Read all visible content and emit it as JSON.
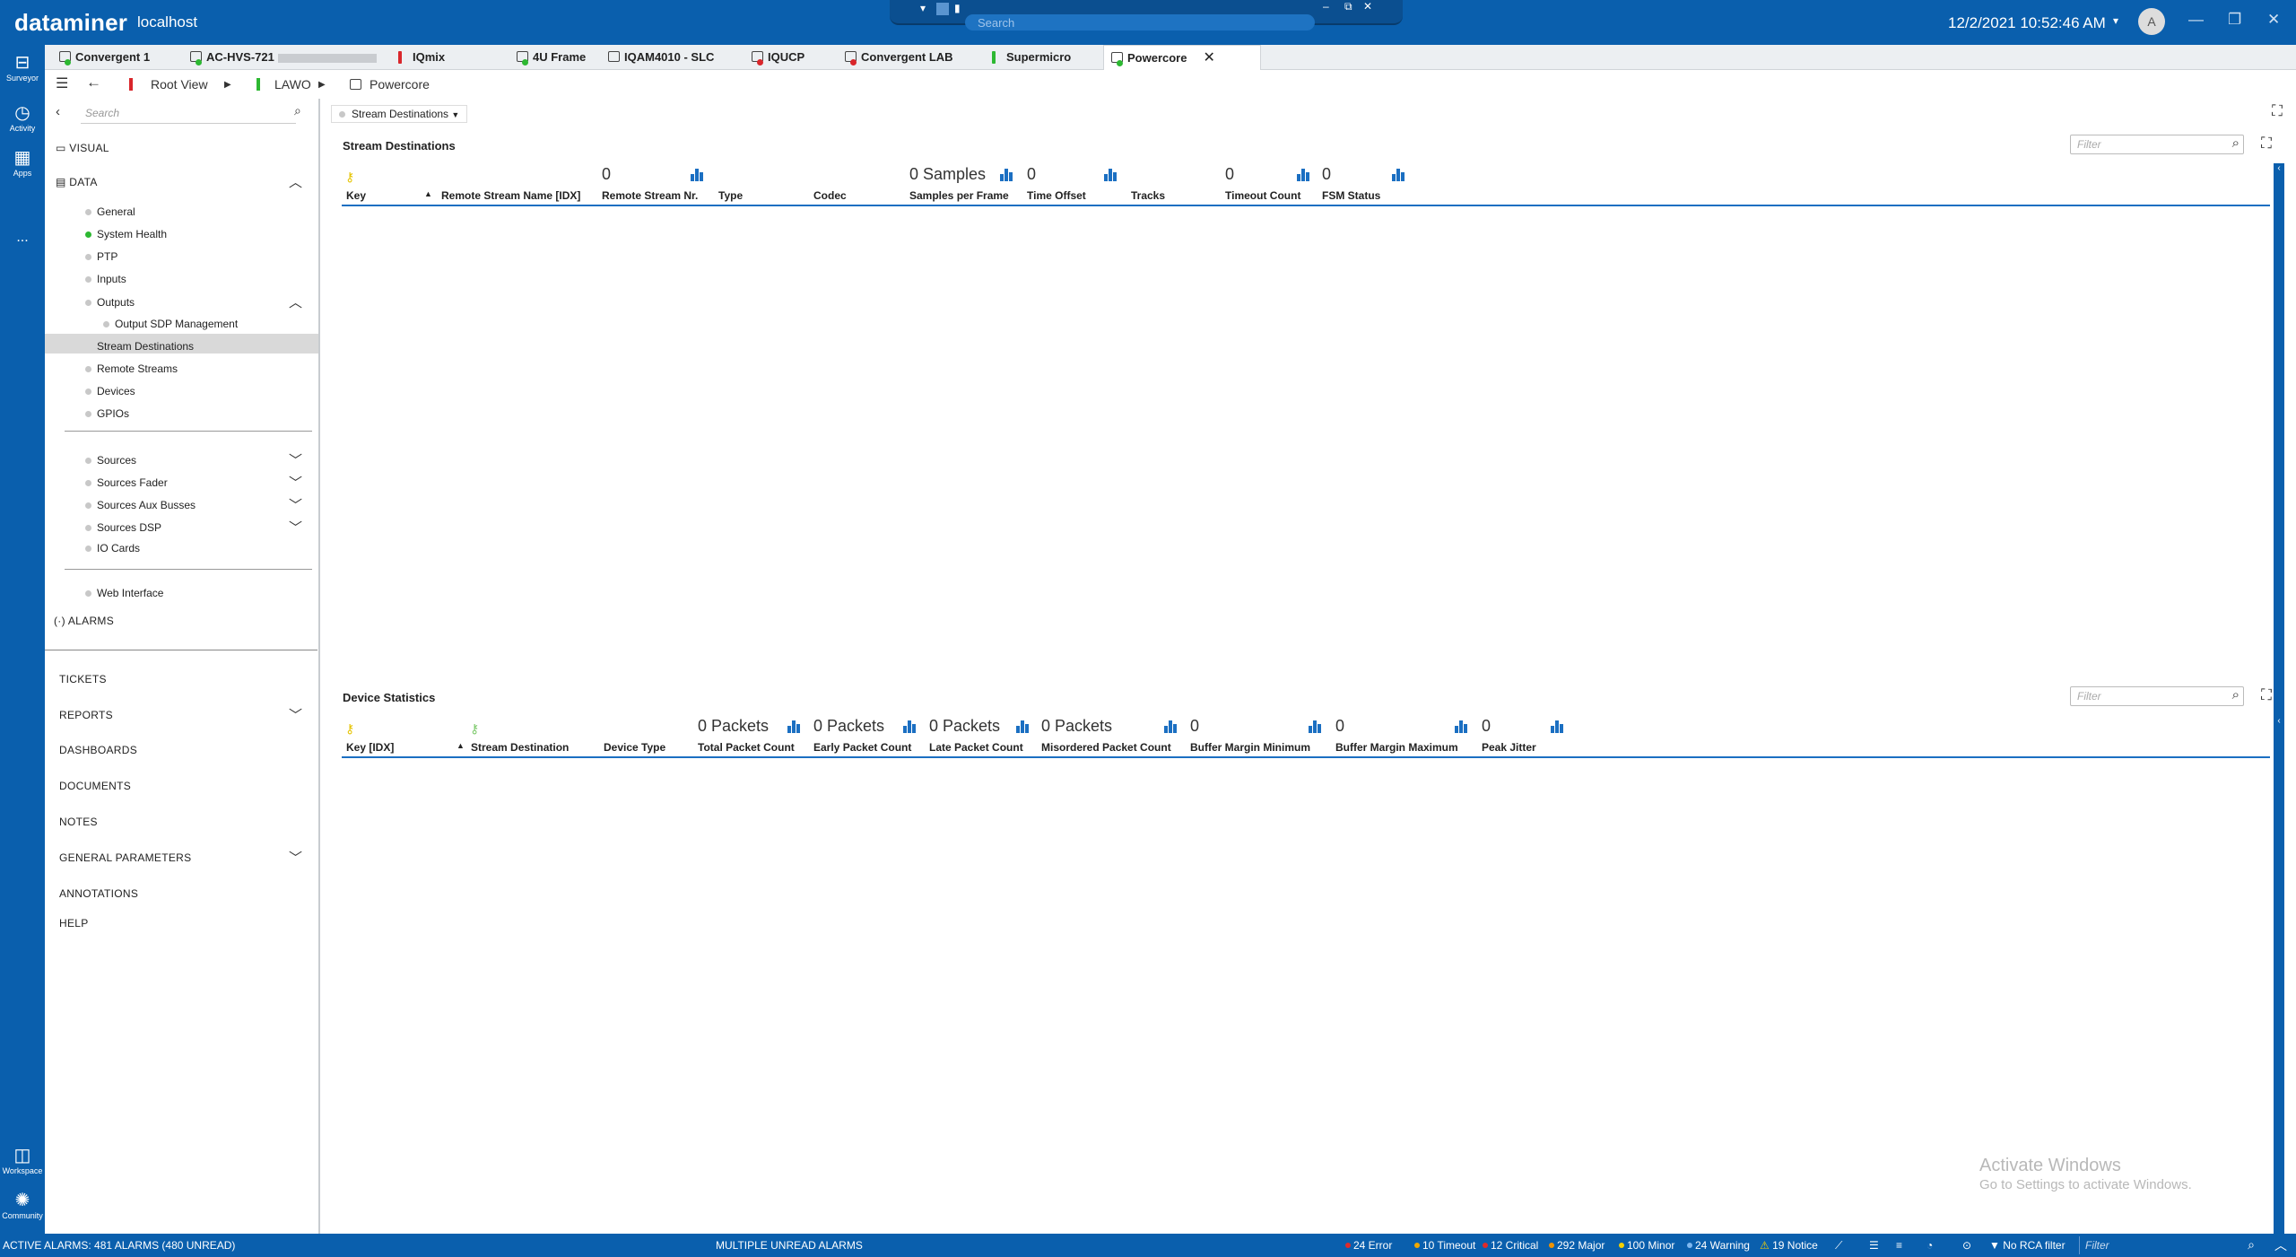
{
  "app": {
    "brand": "dataminer",
    "host": "localhost",
    "datetime": "12/2/2021 10:52:46 AM",
    "user_initial": "A",
    "search_placeholder": "Search",
    "window_search_icons": [
      "chevron-down-icon",
      "apps-icon",
      "signal-icon"
    ]
  },
  "rail": {
    "surveyor": "Surveyor",
    "activity": "Activity",
    "apps": "Apps",
    "more": "...",
    "workspace": "Workspace",
    "community": "Community"
  },
  "tabs": [
    {
      "label": "Convergent 1",
      "status": "#2db832"
    },
    {
      "label": "AC-HVS-721",
      "status": "#2db832"
    },
    {
      "label": "IQmix",
      "status": "#d9262b"
    },
    {
      "label": "4U Frame",
      "status": "#2db832"
    },
    {
      "label": "IQAM4010 - SLC",
      "status": "#c8c8c8"
    },
    {
      "label": "IQUCP",
      "status": "#d9262b"
    },
    {
      "label": "Convergent LAB",
      "status": "#d9262b"
    },
    {
      "label": "Supermicro",
      "status": "#2db832"
    },
    {
      "label": "Powercore",
      "status": "#2db832"
    }
  ],
  "breadcrumb": {
    "root": "Root View",
    "lawo": "LAWO",
    "powercore": "Powercore"
  },
  "sidebar": {
    "search_placeholder": "Search",
    "visual": "VISUAL",
    "data": "DATA",
    "items": {
      "general": "General",
      "system_health": "System Health",
      "ptp": "PTP",
      "inputs": "Inputs",
      "outputs": "Outputs",
      "output_sdp": "Output SDP Management",
      "stream_destinations": "Stream Destinations",
      "remote_streams": "Remote Streams",
      "devices": "Devices",
      "gpios": "GPIOs",
      "sources": "Sources",
      "sources_fader": "Sources Fader",
      "sources_aux": "Sources Aux Busses",
      "sources_dsp": "Sources DSP",
      "io_cards": "IO Cards",
      "web_interface": "Web Interface"
    },
    "alarms": "ALARMS",
    "sections": {
      "tickets": "TICKETS",
      "reports": "REPORTS",
      "dashboards": "DASHBOARDS",
      "documents": "DOCUMENTS",
      "notes": "NOTES",
      "general_parameters": "GENERAL PARAMETERS",
      "annotations": "ANNOTATIONS",
      "help": "HELP"
    }
  },
  "page_select": "Stream Destinations",
  "panel1": {
    "title": "Stream Destinations",
    "filter_placeholder": "Filter",
    "columns": [
      "Key",
      "Remote Stream Name [IDX]",
      "Remote Stream Nr.",
      "Type",
      "Codec",
      "Samples per Frame",
      "Time Offset",
      "Tracks",
      "Timeout Count",
      "FSM Status"
    ],
    "aggregates": {
      "remote_stream_nr": "0",
      "samples_per_frame": "0 Samples",
      "time_offset": "0",
      "timeout_count": "0",
      "fsm_status": "0"
    }
  },
  "panel2": {
    "title": "Device Statistics",
    "filter_placeholder": "Filter",
    "columns": [
      "Key [IDX]",
      "Stream Destination",
      "Device Type",
      "Total Packet Count",
      "Early Packet Count",
      "Late Packet Count",
      "Misordered Packet Count",
      "Buffer Margin Minimum",
      "Buffer Margin Maximum",
      "Peak Jitter"
    ],
    "aggregates": {
      "total_packet_count": "0 Packets",
      "early_packet_count": "0 Packets",
      "late_packet_count": "0 Packets",
      "misordered_packet_count": "0 Packets",
      "buffer_margin_minimum": "0",
      "buffer_margin_maximum": "0",
      "peak_jitter": "0"
    }
  },
  "watermark": {
    "line1": "Activate Windows",
    "line2": "Go to Settings to activate Windows."
  },
  "statusbar": {
    "active_alarms": "ACTIVE ALARMS: 481 ALARMS (480 UNREAD)",
    "multiple_unread": "MULTIPLE UNREAD ALARMS",
    "counts": [
      {
        "label": "24 Error",
        "color": "#e02a2a"
      },
      {
        "label": "10 Timeout",
        "color": "#f1a800"
      },
      {
        "label": "12 Critical",
        "color": "#e02a2a"
      },
      {
        "label": "292 Major",
        "color": "#f19300"
      },
      {
        "label": "100 Minor",
        "color": "#f5d000"
      },
      {
        "label": "24 Warning",
        "color": "#7fb8f0"
      },
      {
        "label": "19 Notice",
        "color": "#f5d000"
      }
    ],
    "rca": "No RCA filter",
    "filter_placeholder": "Filter"
  },
  "colors": {
    "accent": "#0a5fad",
    "chart_blue": "#1b6fc2",
    "selected_row": "#d9d9d9"
  }
}
